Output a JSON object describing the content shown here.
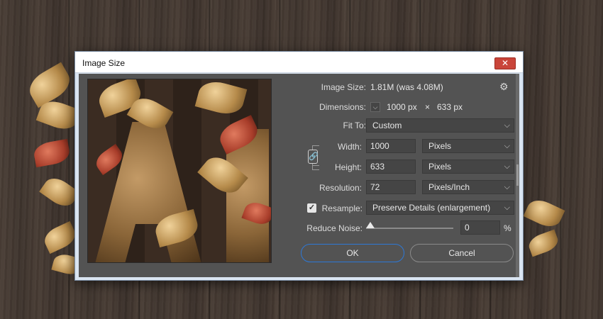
{
  "window": {
    "title": "Image Size",
    "close_label": "✕"
  },
  "image_size": {
    "label": "Image Size:",
    "value": "1.81M (was 4.08M)"
  },
  "dimensions": {
    "label": "Dimensions:",
    "width": "1000 px",
    "times": "×",
    "height": "633 px"
  },
  "fit_to": {
    "label": "Fit To:",
    "value": "Custom"
  },
  "width": {
    "label": "Width:",
    "value": "1000",
    "unit": "Pixels"
  },
  "height": {
    "label": "Height:",
    "value": "633",
    "unit": "Pixels"
  },
  "resolution": {
    "label": "Resolution:",
    "value": "72",
    "unit": "Pixels/Inch"
  },
  "resample": {
    "label": "Resample:",
    "checked": true,
    "value": "Preserve Details (enlargement)"
  },
  "reduce_noise": {
    "label": "Reduce Noise:",
    "value": "0",
    "unit": "%",
    "level": 0
  },
  "buttons": {
    "ok": "OK",
    "cancel": "Cancel"
  },
  "icons": {
    "gear": "⚙",
    "chevron": "⌵",
    "link": "🔗",
    "check": "✓"
  }
}
